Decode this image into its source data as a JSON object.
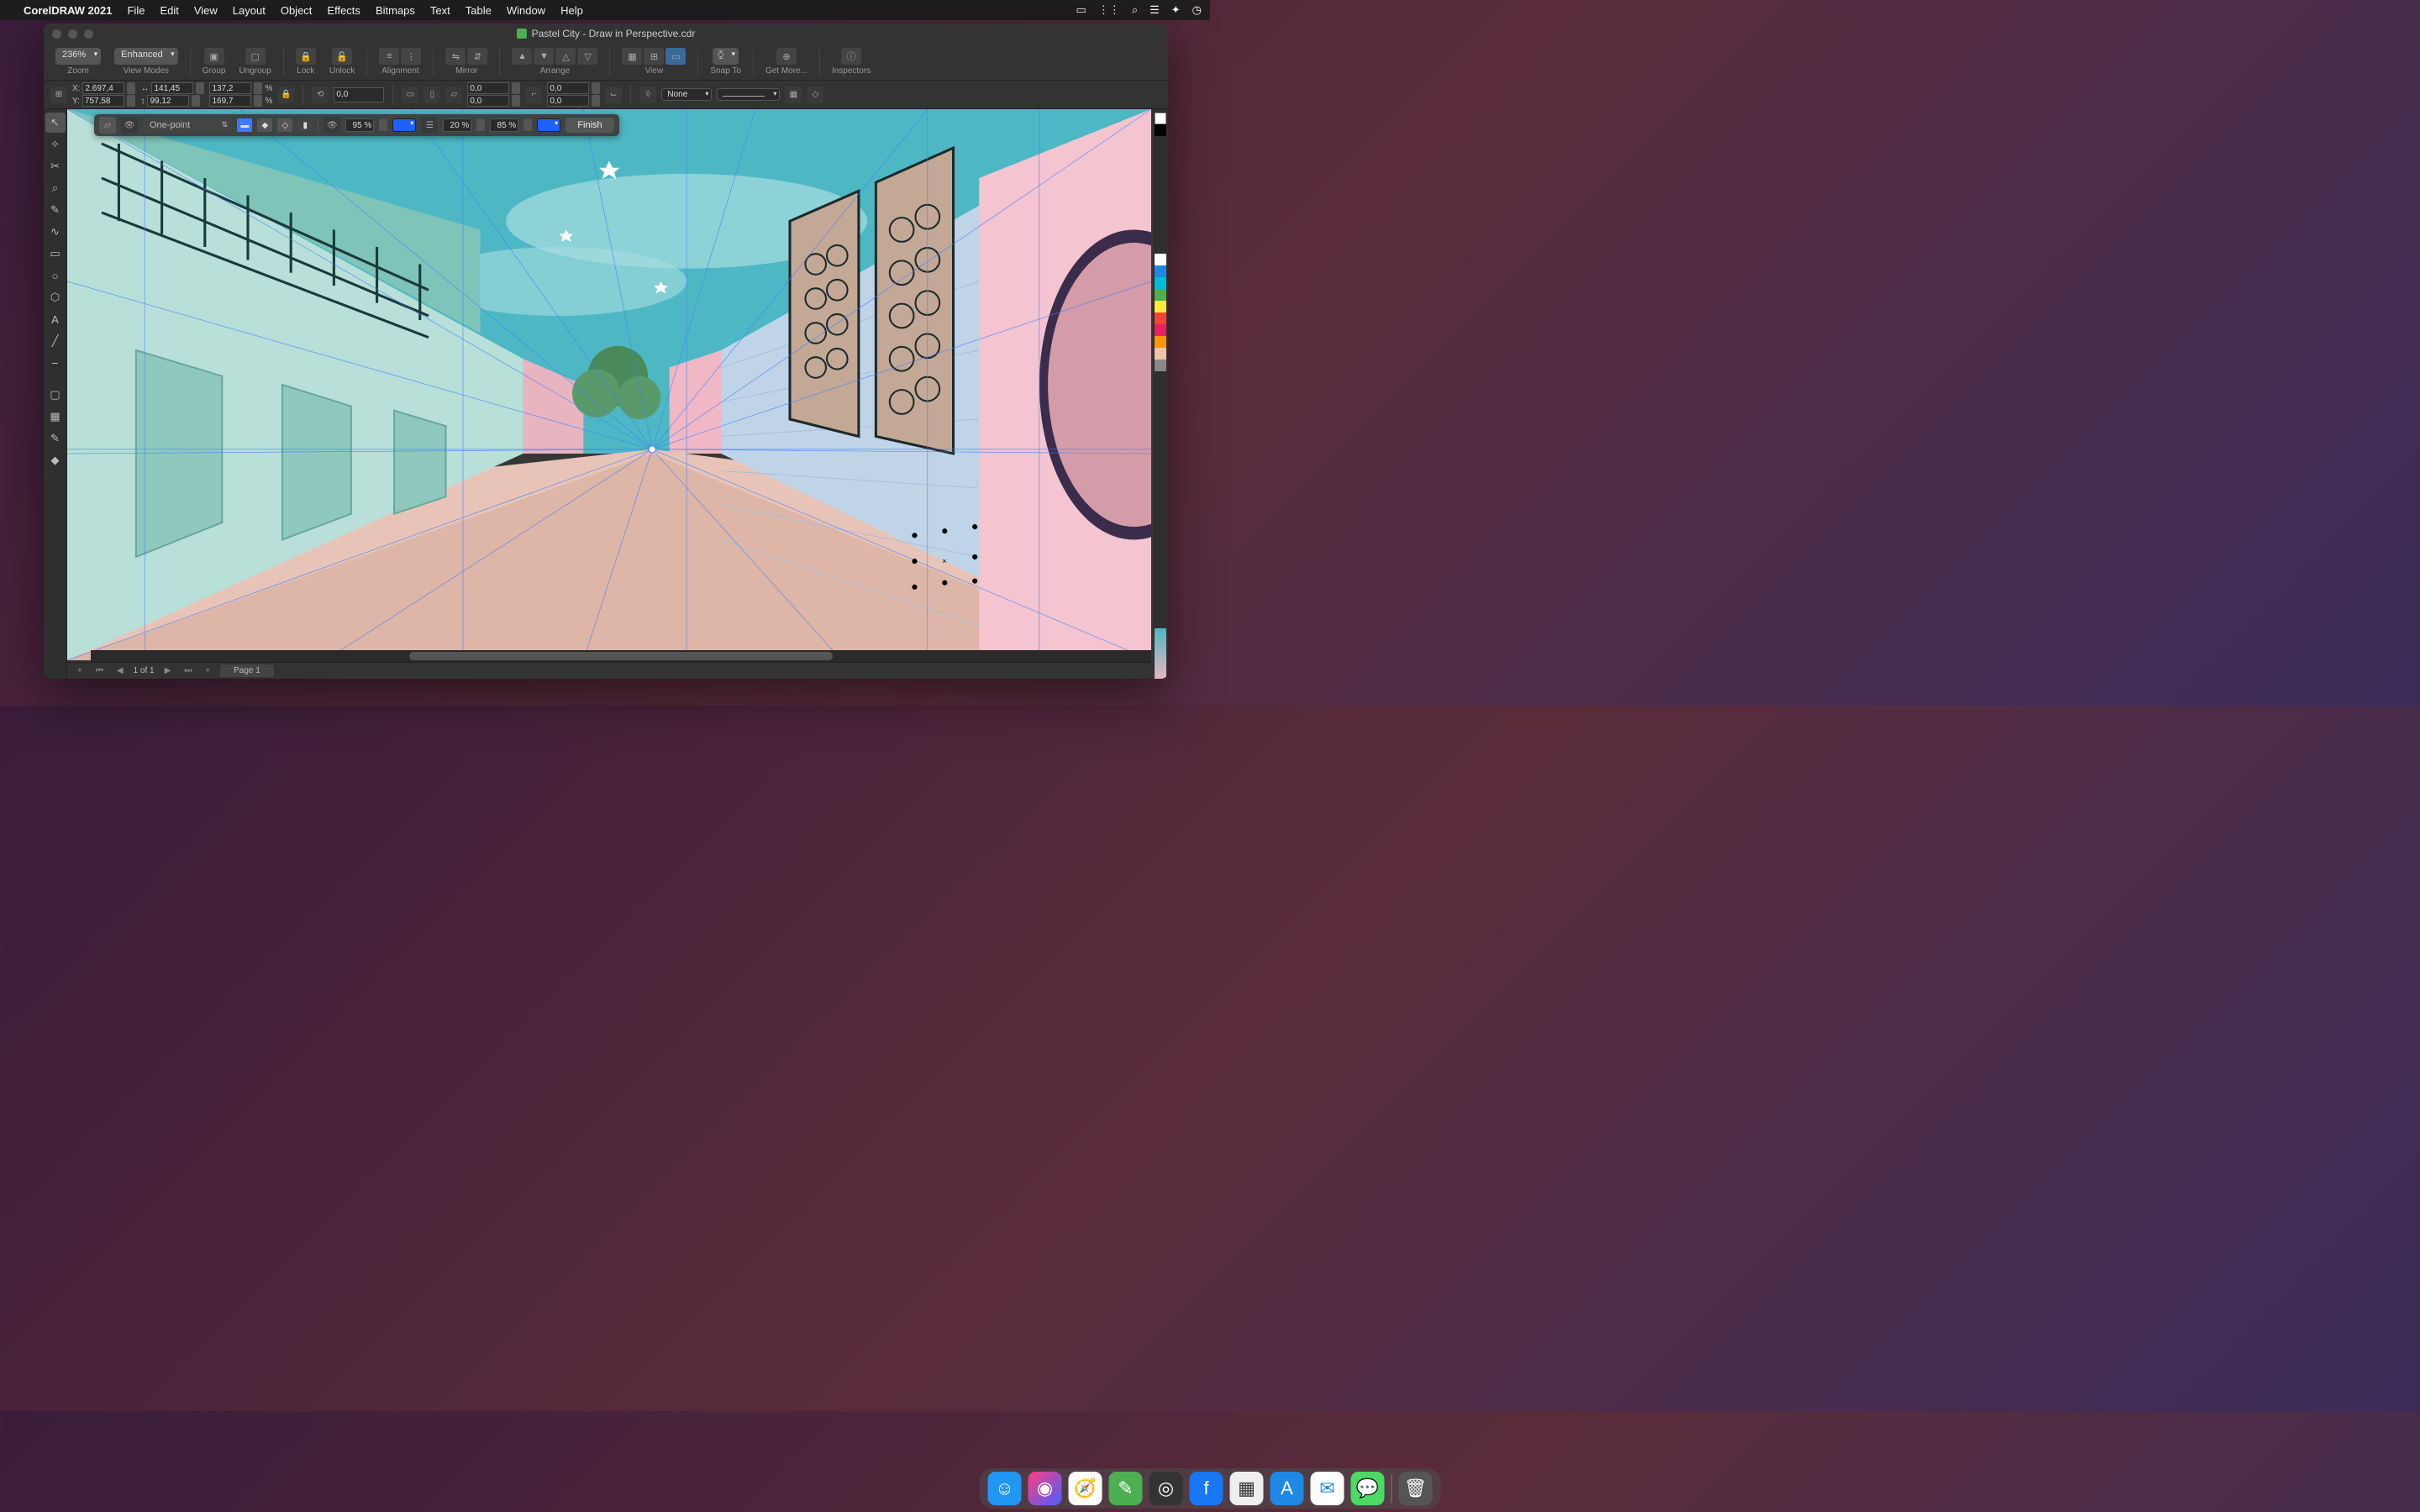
{
  "menubar": {
    "app_name": "CorelDRAW 2021",
    "items": [
      "File",
      "Edit",
      "View",
      "Layout",
      "Object",
      "Effects",
      "Bitmaps",
      "Text",
      "Table",
      "Window",
      "Help"
    ]
  },
  "window": {
    "title": "Pastel City - Draw in Perspective.cdr"
  },
  "toolbar1": {
    "zoom_value": "236%",
    "zoom_label": "Zoom",
    "view_mode_value": "Enhanced",
    "view_modes_label": "View Modes",
    "group_label": "Group",
    "ungroup_label": "Ungroup",
    "lock_label": "Lock",
    "unlock_label": "Unlock",
    "alignment_label": "Alignment",
    "mirror_label": "Mirror",
    "arrange_label": "Arrange",
    "view_label": "View",
    "snap_label": "Snap To",
    "getmore_label": "Get More...",
    "inspectors_label": "Inspectors"
  },
  "propbar": {
    "x_label": "X:",
    "x_value": "2.697,4",
    "y_label": "Y:",
    "y_value": "757,58",
    "w_value": "141,45",
    "h_value": "99,12",
    "sx_value": "137,2",
    "sy_value": "169,7",
    "pct": "%",
    "rot_value": "0,0",
    "sk1": "0,0",
    "sk2": "0,0",
    "cn1": "0,0",
    "cn2": "0,0",
    "outline_value": "None"
  },
  "perspective_bar": {
    "mode": "One-point",
    "opacity1": "95 %",
    "opacity2": "20 %",
    "opacity3": "85 %",
    "color1": "#1e5fff",
    "color2": "#1e5fff",
    "finish_label": "Finish"
  },
  "pagebar": {
    "page_counter": "1  of  1",
    "page_tab": "Page 1",
    "add": "+"
  },
  "palette_colors": [
    "#ffffff",
    "#000000",
    "#222222",
    "#ffffff",
    "#1e88e5",
    "#4caf50",
    "#ffeb3b",
    "#f44336",
    "#e91e63",
    "#9c27b0",
    "#ff9800",
    "#f0c4a8",
    "#888888",
    "#cccccc"
  ],
  "dock_icons": [
    {
      "name": "finder",
      "bg": "#2196f3",
      "glyph": "☺"
    },
    {
      "name": "siri",
      "bg": "linear-gradient(135deg,#ff3d7f,#4a5fff)",
      "glyph": "◉"
    },
    {
      "name": "safari",
      "bg": "#e3f2fd",
      "glyph": "🧭"
    },
    {
      "name": "coreldraw",
      "bg": "#4caf50",
      "glyph": "✎"
    },
    {
      "name": "camera",
      "bg": "#333",
      "glyph": "◎"
    },
    {
      "name": "facebook",
      "bg": "#1877f2",
      "glyph": "f"
    },
    {
      "name": "launchpad",
      "bg": "#eee",
      "glyph": "▦"
    },
    {
      "name": "appstore",
      "bg": "#1e88e5",
      "glyph": "A"
    },
    {
      "name": "mail",
      "bg": "#e3f2fd",
      "glyph": "✉"
    },
    {
      "name": "messages",
      "bg": "#4cd964",
      "glyph": "💬"
    }
  ],
  "trash_glyph": "🗑"
}
